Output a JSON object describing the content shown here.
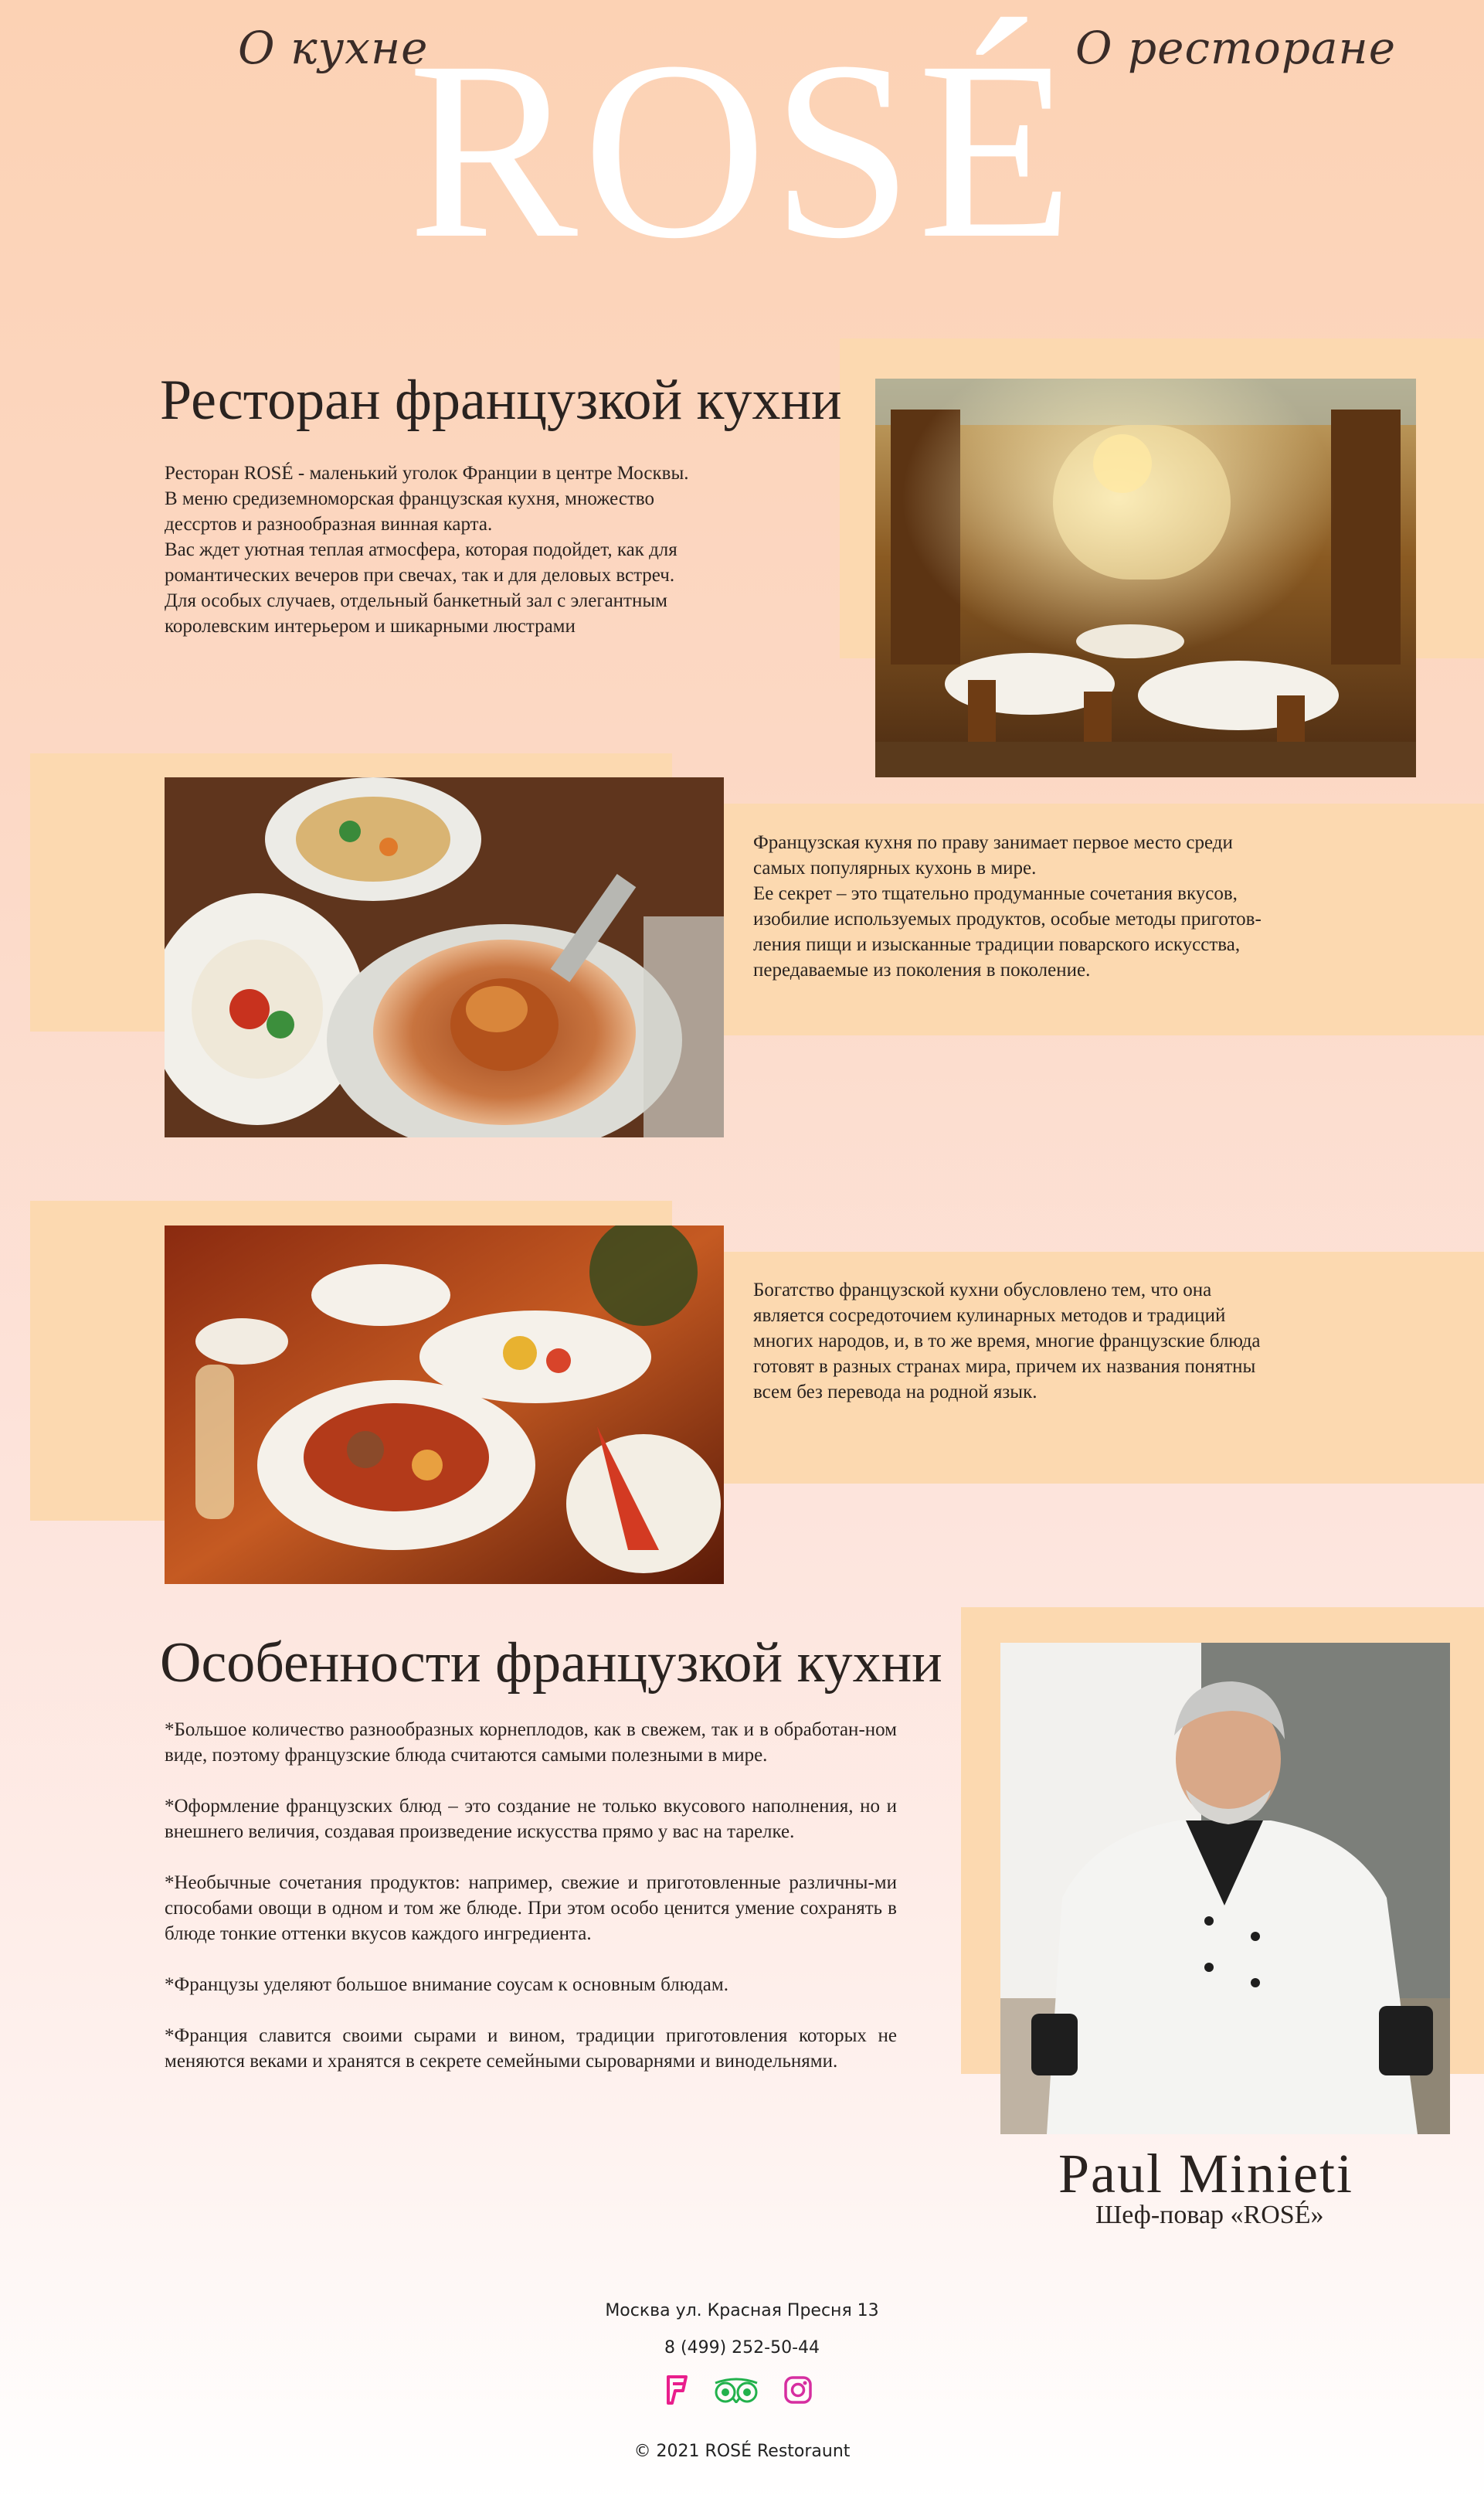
{
  "nav": {
    "left_label": "О кухне",
    "right_label": "О ресторане"
  },
  "logo": "ROSÉ",
  "intro": {
    "title": "Ресторан французкой кухни",
    "lines": [
      "Ресторан ROSÉ  - маленький уголок Франции в центре Москвы.",
      "В меню средиземноморская французская кухня, множество",
      "дессртов и разнообразная винная карта.",
      "Вас ждет уютная теплая атмосфера, которая подойдет, как для",
      "романтических вечеров при свечах, так и для деловых встреч.",
      "Для особых случаев, отдельный банкетный зал с элегантным",
      "королевским интерьером и шикарными люстрами"
    ]
  },
  "cuisine1": {
    "lines": [
      "Французская кухня по праву занимает первое место среди",
      "самых популярных кухонь в мире.",
      "Ее секрет – это тщательно продуманные сочетания вкусов,",
      "изобилие используемых продуктов, особые методы приготов-",
      "ления пищи и изысканные традиции поварского искусства,",
      "передаваемые из поколения в поколение."
    ]
  },
  "cuisine2": {
    "lines": [
      "Богатство французской кухни обусловлено тем, что она",
      "является сосредоточием кулинарных методов и традиций",
      "многих народов, и, в то же время, многие французские блюда",
      "готовят в разных странах мира, причем их названия понятны",
      "всем без перевода на родной язык."
    ]
  },
  "features": {
    "title": "Особенности французкой кухни",
    "items": [
      "*Большое количество разнообразных корнеплодов, как в свежем, так и в обработан-ном виде, поэтому французские блюда считаются самыми полезными в мире.",
      "*Оформление французских блюд – это создание не только вкусового наполнения, но и внешнего величия, создавая произведение искусства прямо у вас на тарелке.",
      "*Необычные сочетания продуктов: например, свежие и приготовленные различны-ми способами овощи в одном и том же блюде. При этом особо ценится умение сохранять в блюде тонкие оттенки вкусов каждого ингредиента.",
      "*Французы уделяют большое внимание соусам к основным блюдам.",
      "*Франция славится своими сырами и вином, традиции приготовления которых не меняются веками и хранятся в секрете семейными сыроварнями и винодельнями."
    ]
  },
  "chef": {
    "name": "Paul Minieti",
    "role": "Шеф-повар «ROSÉ»"
  },
  "footer": {
    "address": "Москва ул. Красная Пресня 13",
    "phone": "8 (499) 252-50-44",
    "copyright": "© 2021 ROSÉ Restoraunt",
    "social_icons": [
      "foursquare-icon",
      "tripadvisor-icon",
      "instagram-icon"
    ],
    "colors": {
      "foursquare": "#e91e8c",
      "tripadvisor": "#22b14c",
      "instagram": "#d62ea0"
    }
  },
  "colors": {
    "accent_block": "#fcd9b0",
    "logo": "#ffffff"
  }
}
